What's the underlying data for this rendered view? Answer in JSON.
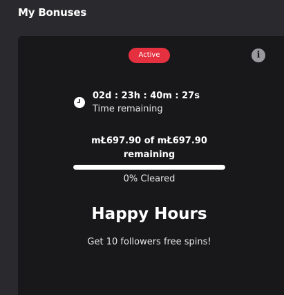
{
  "page": {
    "title": "My Bonuses"
  },
  "bonus": {
    "status": "Active",
    "info_icon": "info-icon",
    "clock_icon": "clock-icon",
    "timer_value": "02d : 23h : 40m : 27s",
    "timer_label": "Time remaining",
    "amount_line1": "mŁ697.90 of mŁ697.90",
    "amount_line2": "remaining",
    "progress_fraction": 0,
    "cleared_text": "0% Cleared",
    "title": "Happy Hours",
    "description": "Get 10 followers free spins!"
  },
  "colors": {
    "page_bg": "#2a2a2e",
    "card_bg": "#18181b",
    "badge_bg": "#e5303f",
    "progress_fill": "#ffffff"
  }
}
